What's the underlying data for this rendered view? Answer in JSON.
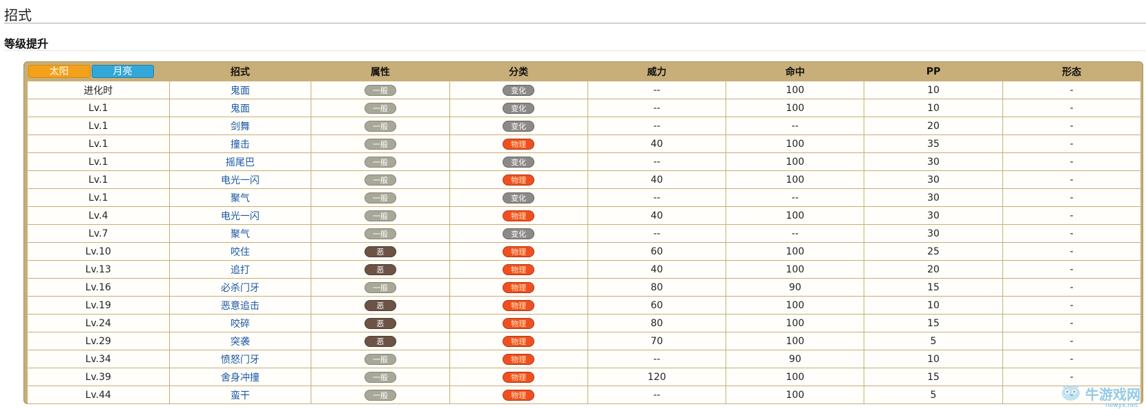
{
  "page": {
    "title": "招式",
    "section": "等级提升"
  },
  "tabs": {
    "sun": "太阳",
    "moon": "月亮"
  },
  "columns": [
    "招式",
    "属性",
    "分类",
    "威力",
    "命中",
    "PP",
    "形态"
  ],
  "rows": [
    {
      "lv": "进化时",
      "move": "鬼面",
      "type": "一般",
      "cat": "变化",
      "pow": "--",
      "acc": "100",
      "pp": "10",
      "form": "-"
    },
    {
      "lv": "Lv.1",
      "move": "鬼面",
      "type": "一般",
      "cat": "变化",
      "pow": "--",
      "acc": "100",
      "pp": "10",
      "form": "-"
    },
    {
      "lv": "Lv.1",
      "move": "剑舞",
      "type": "一般",
      "cat": "变化",
      "pow": "--",
      "acc": "--",
      "pp": "20",
      "form": "-"
    },
    {
      "lv": "Lv.1",
      "move": "撞击",
      "type": "一般",
      "cat": "物理",
      "pow": "40",
      "acc": "100",
      "pp": "35",
      "form": "-"
    },
    {
      "lv": "Lv.1",
      "move": "摇尾巴",
      "type": "一般",
      "cat": "变化",
      "pow": "--",
      "acc": "100",
      "pp": "30",
      "form": "-"
    },
    {
      "lv": "Lv.1",
      "move": "电光一闪",
      "type": "一般",
      "cat": "物理",
      "pow": "40",
      "acc": "100",
      "pp": "30",
      "form": "-"
    },
    {
      "lv": "Lv.1",
      "move": "聚气",
      "type": "一般",
      "cat": "变化",
      "pow": "--",
      "acc": "--",
      "pp": "30",
      "form": "-"
    },
    {
      "lv": "Lv.4",
      "move": "电光一闪",
      "type": "一般",
      "cat": "物理",
      "pow": "40",
      "acc": "100",
      "pp": "30",
      "form": "-"
    },
    {
      "lv": "Lv.7",
      "move": "聚气",
      "type": "一般",
      "cat": "变化",
      "pow": "--",
      "acc": "--",
      "pp": "30",
      "form": "-"
    },
    {
      "lv": "Lv.10",
      "move": "咬住",
      "type": "恶",
      "cat": "物理",
      "pow": "60",
      "acc": "100",
      "pp": "25",
      "form": "-"
    },
    {
      "lv": "Lv.13",
      "move": "追打",
      "type": "恶",
      "cat": "物理",
      "pow": "40",
      "acc": "100",
      "pp": "20",
      "form": "-"
    },
    {
      "lv": "Lv.16",
      "move": "必杀门牙",
      "type": "一般",
      "cat": "物理",
      "pow": "80",
      "acc": "90",
      "pp": "15",
      "form": "-"
    },
    {
      "lv": "Lv.19",
      "move": "恶意追击",
      "type": "恶",
      "cat": "物理",
      "pow": "60",
      "acc": "100",
      "pp": "10",
      "form": "-"
    },
    {
      "lv": "Lv.24",
      "move": "咬碎",
      "type": "恶",
      "cat": "物理",
      "pow": "80",
      "acc": "100",
      "pp": "15",
      "form": "-"
    },
    {
      "lv": "Lv.29",
      "move": "突袭",
      "type": "恶",
      "cat": "物理",
      "pow": "70",
      "acc": "100",
      "pp": "5",
      "form": "-"
    },
    {
      "lv": "Lv.34",
      "move": "愤怒门牙",
      "type": "一般",
      "cat": "物理",
      "pow": "--",
      "acc": "90",
      "pp": "10",
      "form": "-"
    },
    {
      "lv": "Lv.39",
      "move": "舍身冲撞",
      "type": "一般",
      "cat": "物理",
      "pow": "120",
      "acc": "100",
      "pp": "15",
      "form": "-"
    },
    {
      "lv": "Lv.44",
      "move": "蛮干",
      "type": "一般",
      "cat": "物理",
      "pow": "--",
      "acc": "100",
      "pp": "5",
      "form": "-"
    }
  ],
  "watermark": {
    "text": "牛游戏网",
    "sub": "newyx.net"
  },
  "colors": {
    "sun_tab": "#f3a11a",
    "moon_tab": "#33a7d8",
    "table_frame": "#c8ae78",
    "move_link": "#1a57a5"
  }
}
